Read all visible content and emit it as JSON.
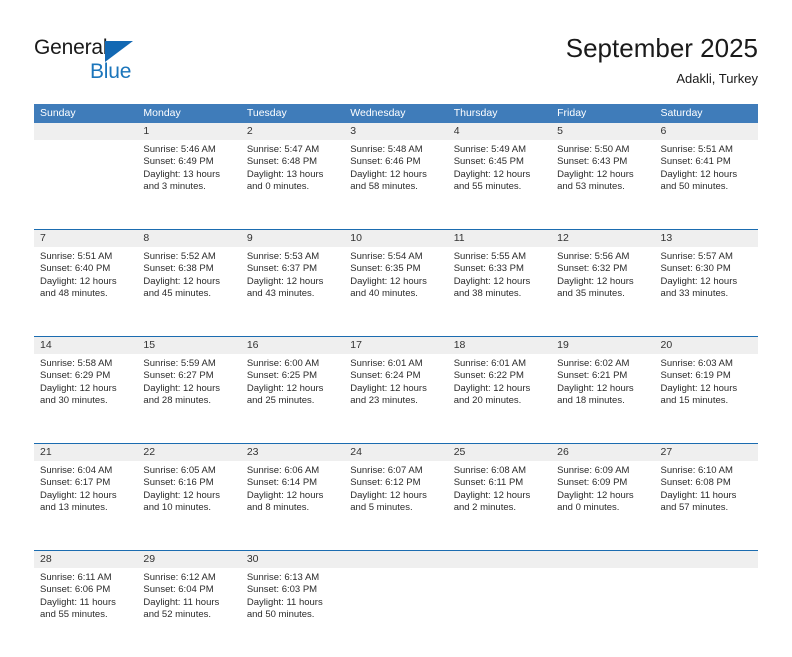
{
  "brand": {
    "name_top": "General",
    "name_bottom": "Blue"
  },
  "header": {
    "title": "September 2025",
    "location": "Adakli, Turkey"
  },
  "colors": {
    "header_blue": "#3f7cba",
    "separator_blue": "#1b6cb0",
    "day_band_gray": "#efefef",
    "brand_blue": "#1b75bb"
  },
  "weekdays": [
    "Sunday",
    "Monday",
    "Tuesday",
    "Wednesday",
    "Thursday",
    "Friday",
    "Saturday"
  ],
  "weeks": [
    [
      {
        "day": "",
        "sunrise": "",
        "sunset": "",
        "daylight": "",
        "empty": true
      },
      {
        "day": "1",
        "sunrise": "Sunrise: 5:46 AM",
        "sunset": "Sunset: 6:49 PM",
        "daylight": "Daylight: 13 hours and 3 minutes."
      },
      {
        "day": "2",
        "sunrise": "Sunrise: 5:47 AM",
        "sunset": "Sunset: 6:48 PM",
        "daylight": "Daylight: 13 hours and 0 minutes."
      },
      {
        "day": "3",
        "sunrise": "Sunrise: 5:48 AM",
        "sunset": "Sunset: 6:46 PM",
        "daylight": "Daylight: 12 hours and 58 minutes."
      },
      {
        "day": "4",
        "sunrise": "Sunrise: 5:49 AM",
        "sunset": "Sunset: 6:45 PM",
        "daylight": "Daylight: 12 hours and 55 minutes."
      },
      {
        "day": "5",
        "sunrise": "Sunrise: 5:50 AM",
        "sunset": "Sunset: 6:43 PM",
        "daylight": "Daylight: 12 hours and 53 minutes."
      },
      {
        "day": "6",
        "sunrise": "Sunrise: 5:51 AM",
        "sunset": "Sunset: 6:41 PM",
        "daylight": "Daylight: 12 hours and 50 minutes."
      }
    ],
    [
      {
        "day": "7",
        "sunrise": "Sunrise: 5:51 AM",
        "sunset": "Sunset: 6:40 PM",
        "daylight": "Daylight: 12 hours and 48 minutes."
      },
      {
        "day": "8",
        "sunrise": "Sunrise: 5:52 AM",
        "sunset": "Sunset: 6:38 PM",
        "daylight": "Daylight: 12 hours and 45 minutes."
      },
      {
        "day": "9",
        "sunrise": "Sunrise: 5:53 AM",
        "sunset": "Sunset: 6:37 PM",
        "daylight": "Daylight: 12 hours and 43 minutes."
      },
      {
        "day": "10",
        "sunrise": "Sunrise: 5:54 AM",
        "sunset": "Sunset: 6:35 PM",
        "daylight": "Daylight: 12 hours and 40 minutes."
      },
      {
        "day": "11",
        "sunrise": "Sunrise: 5:55 AM",
        "sunset": "Sunset: 6:33 PM",
        "daylight": "Daylight: 12 hours and 38 minutes."
      },
      {
        "day": "12",
        "sunrise": "Sunrise: 5:56 AM",
        "sunset": "Sunset: 6:32 PM",
        "daylight": "Daylight: 12 hours and 35 minutes."
      },
      {
        "day": "13",
        "sunrise": "Sunrise: 5:57 AM",
        "sunset": "Sunset: 6:30 PM",
        "daylight": "Daylight: 12 hours and 33 minutes."
      }
    ],
    [
      {
        "day": "14",
        "sunrise": "Sunrise: 5:58 AM",
        "sunset": "Sunset: 6:29 PM",
        "daylight": "Daylight: 12 hours and 30 minutes."
      },
      {
        "day": "15",
        "sunrise": "Sunrise: 5:59 AM",
        "sunset": "Sunset: 6:27 PM",
        "daylight": "Daylight: 12 hours and 28 minutes."
      },
      {
        "day": "16",
        "sunrise": "Sunrise: 6:00 AM",
        "sunset": "Sunset: 6:25 PM",
        "daylight": "Daylight: 12 hours and 25 minutes."
      },
      {
        "day": "17",
        "sunrise": "Sunrise: 6:01 AM",
        "sunset": "Sunset: 6:24 PM",
        "daylight": "Daylight: 12 hours and 23 minutes."
      },
      {
        "day": "18",
        "sunrise": "Sunrise: 6:01 AM",
        "sunset": "Sunset: 6:22 PM",
        "daylight": "Daylight: 12 hours and 20 minutes."
      },
      {
        "day": "19",
        "sunrise": "Sunrise: 6:02 AM",
        "sunset": "Sunset: 6:21 PM",
        "daylight": "Daylight: 12 hours and 18 minutes."
      },
      {
        "day": "20",
        "sunrise": "Sunrise: 6:03 AM",
        "sunset": "Sunset: 6:19 PM",
        "daylight": "Daylight: 12 hours and 15 minutes."
      }
    ],
    [
      {
        "day": "21",
        "sunrise": "Sunrise: 6:04 AM",
        "sunset": "Sunset: 6:17 PM",
        "daylight": "Daylight: 12 hours and 13 minutes."
      },
      {
        "day": "22",
        "sunrise": "Sunrise: 6:05 AM",
        "sunset": "Sunset: 6:16 PM",
        "daylight": "Daylight: 12 hours and 10 minutes."
      },
      {
        "day": "23",
        "sunrise": "Sunrise: 6:06 AM",
        "sunset": "Sunset: 6:14 PM",
        "daylight": "Daylight: 12 hours and 8 minutes."
      },
      {
        "day": "24",
        "sunrise": "Sunrise: 6:07 AM",
        "sunset": "Sunset: 6:12 PM",
        "daylight": "Daylight: 12 hours and 5 minutes."
      },
      {
        "day": "25",
        "sunrise": "Sunrise: 6:08 AM",
        "sunset": "Sunset: 6:11 PM",
        "daylight": "Daylight: 12 hours and 2 minutes."
      },
      {
        "day": "26",
        "sunrise": "Sunrise: 6:09 AM",
        "sunset": "Sunset: 6:09 PM",
        "daylight": "Daylight: 12 hours and 0 minutes."
      },
      {
        "day": "27",
        "sunrise": "Sunrise: 6:10 AM",
        "sunset": "Sunset: 6:08 PM",
        "daylight": "Daylight: 11 hours and 57 minutes."
      }
    ],
    [
      {
        "day": "28",
        "sunrise": "Sunrise: 6:11 AM",
        "sunset": "Sunset: 6:06 PM",
        "daylight": "Daylight: 11 hours and 55 minutes."
      },
      {
        "day": "29",
        "sunrise": "Sunrise: 6:12 AM",
        "sunset": "Sunset: 6:04 PM",
        "daylight": "Daylight: 11 hours and 52 minutes."
      },
      {
        "day": "30",
        "sunrise": "Sunrise: 6:13 AM",
        "sunset": "Sunset: 6:03 PM",
        "daylight": "Daylight: 11 hours and 50 minutes."
      },
      {
        "day": "",
        "sunrise": "",
        "sunset": "",
        "daylight": "",
        "empty": true
      },
      {
        "day": "",
        "sunrise": "",
        "sunset": "",
        "daylight": "",
        "empty": true
      },
      {
        "day": "",
        "sunrise": "",
        "sunset": "",
        "daylight": "",
        "empty": true
      },
      {
        "day": "",
        "sunrise": "",
        "sunset": "",
        "daylight": "",
        "empty": true
      }
    ]
  ]
}
